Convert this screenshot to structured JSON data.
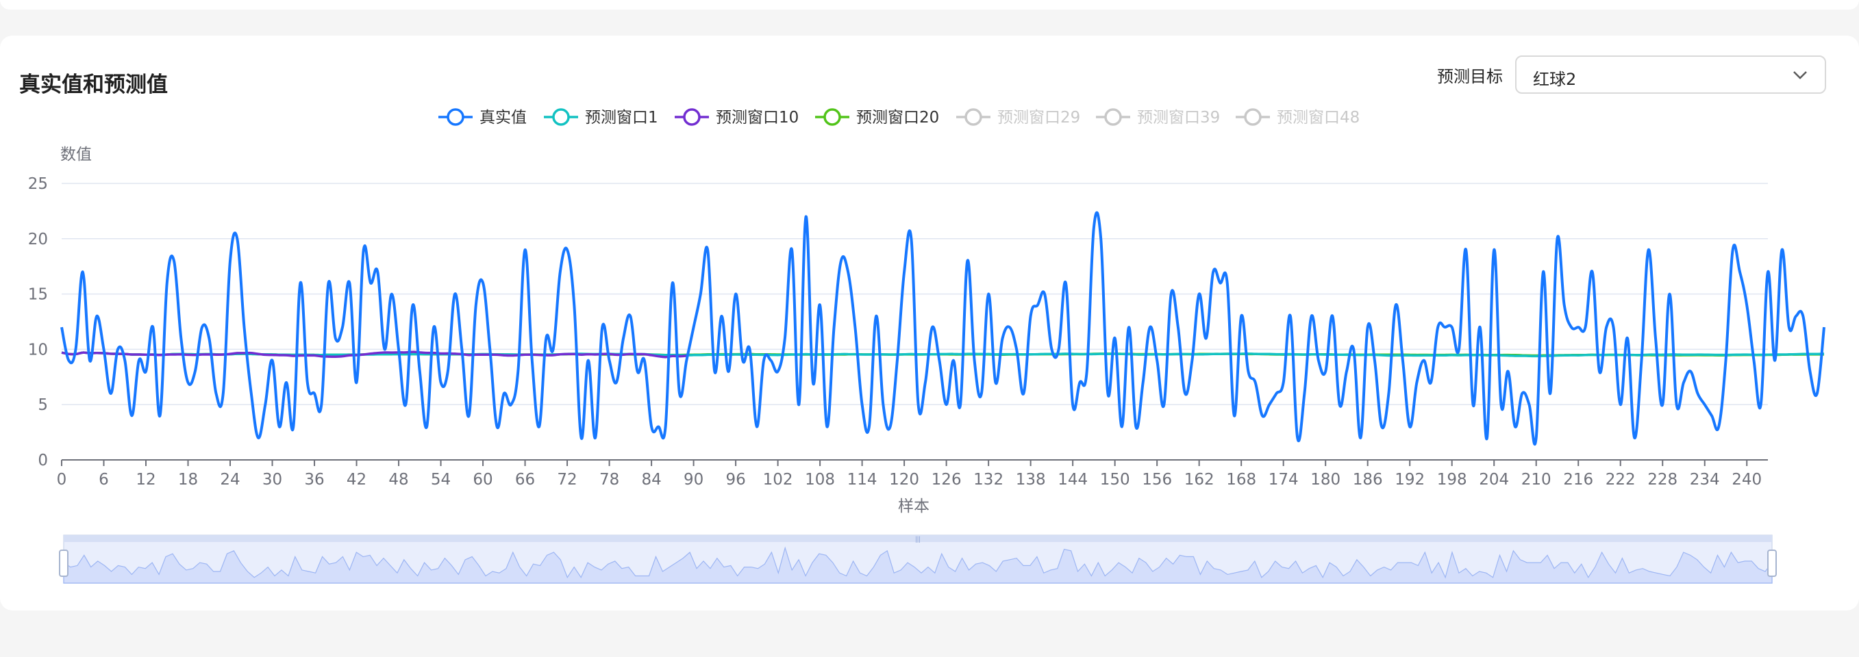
{
  "card": {
    "title": "真实值和预测值",
    "target_label": "预测目标",
    "target_value": "红球2"
  },
  "colors": {
    "actual": "#1677ff",
    "window1": "#13c2c2",
    "window10": "#722ed1",
    "window20": "#52c41a",
    "inactive": "#c8c8c8",
    "grid": "#e0e6f1",
    "axis": "#6e7079",
    "slider_fill": "#d4defb",
    "slider_line": "#9cb5f3"
  },
  "chart_data": {
    "type": "line",
    "ylabel": "数值",
    "xlabel": "样本",
    "ylim": [
      0,
      25
    ],
    "yticks": [
      0,
      5,
      10,
      15,
      20,
      25
    ],
    "xlim": [
      0,
      243
    ],
    "xticks": [
      0,
      6,
      12,
      18,
      24,
      30,
      36,
      42,
      48,
      54,
      60,
      66,
      72,
      78,
      84,
      90,
      96,
      102,
      108,
      114,
      120,
      126,
      132,
      138,
      144,
      150,
      156,
      162,
      168,
      174,
      180,
      186,
      192,
      198,
      204,
      210,
      216,
      222,
      228,
      234,
      240
    ],
    "grid": true,
    "legend_position": "top-center",
    "legend": [
      {
        "name": "真实值",
        "active": true
      },
      {
        "name": "预测窗口1",
        "active": true
      },
      {
        "name": "预测窗口10",
        "active": true
      },
      {
        "name": "预测窗口20",
        "active": true
      },
      {
        "name": "预测窗口29",
        "active": false
      },
      {
        "name": "预测窗口39",
        "active": false
      },
      {
        "name": "预测窗口48",
        "active": false
      }
    ],
    "series": [
      {
        "name": "真实值",
        "values": [
          12,
          9,
          10,
          17,
          9,
          13,
          10,
          6,
          10,
          9,
          4,
          9,
          8,
          12,
          4,
          16,
          18,
          11,
          7,
          8,
          12,
          11,
          6,
          6,
          18,
          20,
          12,
          6,
          2,
          5,
          9,
          3,
          7,
          3,
          16,
          7,
          6,
          5,
          16,
          11,
          12,
          16,
          7,
          19,
          16,
          17,
          10,
          15,
          10,
          5,
          14,
          8,
          3,
          12,
          7,
          8,
          15,
          10,
          4,
          14,
          16,
          10,
          3,
          6,
          5,
          8,
          19,
          9,
          3,
          11,
          10,
          17,
          19,
          14,
          2,
          9,
          2,
          12,
          9,
          7,
          11,
          13,
          8,
          9,
          3,
          3,
          3,
          16,
          6,
          9,
          12,
          15,
          19,
          8,
          13,
          8,
          15,
          9,
          10,
          3,
          9,
          9,
          8,
          11,
          19,
          5,
          22,
          7,
          14,
          3,
          12,
          18,
          17,
          12,
          5,
          3,
          13,
          5,
          3,
          9,
          17,
          20,
          5,
          7,
          12,
          9,
          5,
          9,
          5,
          18,
          9,
          6,
          15,
          7,
          11,
          12,
          10,
          6,
          13,
          14,
          15,
          10,
          10,
          16,
          5,
          7,
          8,
          21,
          20,
          6,
          11,
          3,
          12,
          3,
          7,
          12,
          9,
          5,
          15,
          12,
          6,
          9,
          15,
          11,
          17,
          16,
          16,
          4,
          13,
          8,
          7,
          4,
          5,
          6,
          7,
          13,
          2,
          6,
          13,
          9,
          8,
          13,
          5,
          8,
          10,
          2,
          12,
          9,
          3,
          6,
          14,
          9,
          3,
          7,
          9,
          7,
          12,
          12,
          12,
          10,
          19,
          5,
          12,
          2,
          19,
          5,
          8,
          3,
          6,
          5,
          2,
          17,
          6,
          20,
          14,
          12,
          12,
          12,
          17,
          8,
          12,
          12,
          5,
          11,
          2,
          9,
          19,
          11,
          5,
          15,
          5,
          7,
          8,
          6,
          5,
          4,
          3,
          9,
          19,
          17,
          14,
          9,
          5,
          17,
          9,
          19,
          12,
          13,
          13,
          8,
          6,
          12
        ]
      },
      {
        "name": "预测窗口1",
        "values": []
      },
      {
        "name": "预测窗口10",
        "values": []
      },
      {
        "name": "预测窗口20",
        "values": []
      }
    ]
  }
}
